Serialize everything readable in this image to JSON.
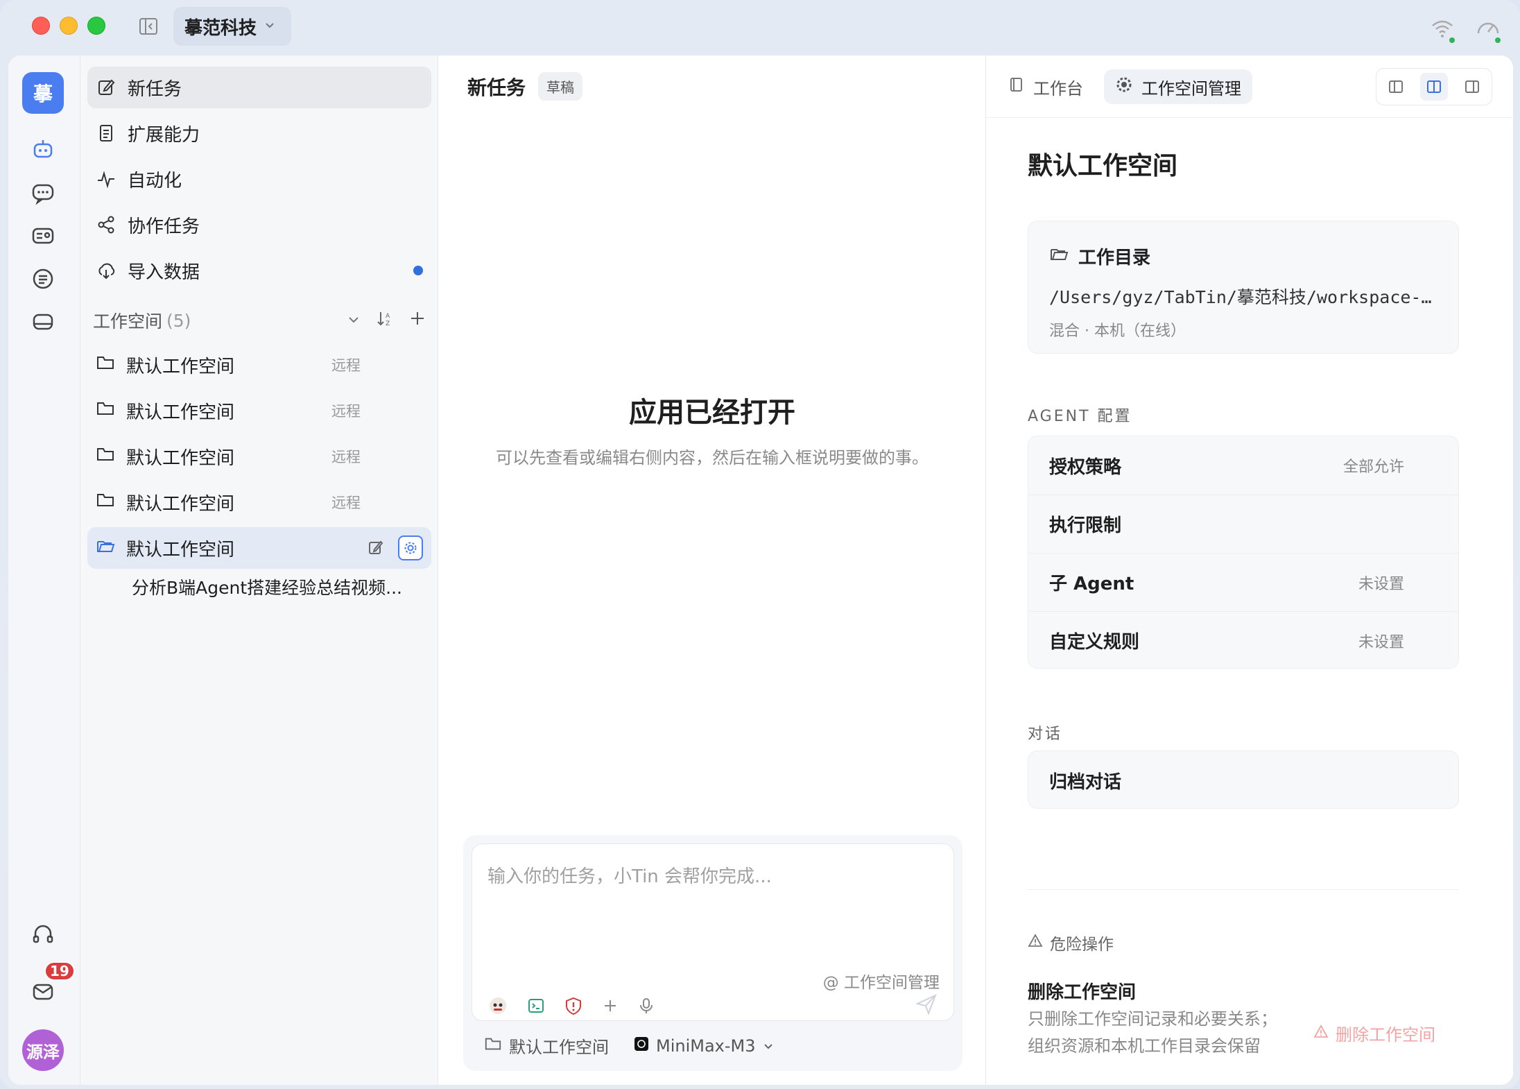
{
  "titlebar": {
    "org_name": "摹范科技"
  },
  "rail": {
    "logo_text": "摹",
    "mail_badge": "19",
    "avatar_text": "源泽"
  },
  "nav": {
    "items": [
      {
        "label": "新任务",
        "icon": "edit-icon"
      },
      {
        "label": "扩展能力",
        "icon": "document-icon"
      },
      {
        "label": "自动化",
        "icon": "pulse-icon"
      },
      {
        "label": "协作任务",
        "icon": "share-icon"
      },
      {
        "label": "导入数据",
        "icon": "cloud-download-icon"
      }
    ]
  },
  "workspaces": {
    "title": "工作空间",
    "count": "(5)",
    "items": [
      {
        "label": "默认工作空间",
        "tag": "远程"
      },
      {
        "label": "默认工作空间",
        "tag": "远程"
      },
      {
        "label": "默认工作空间",
        "tag": "远程"
      },
      {
        "label": "默认工作空间",
        "tag": "远程"
      },
      {
        "label": "默认工作空间",
        "tag": ""
      }
    ],
    "sub_task": "分析B端Agent搭建经验总结视频..."
  },
  "center": {
    "title": "新任务",
    "draft_badge": "草稿",
    "empty_title": "应用已经打开",
    "empty_subtitle": "可以先查看或编辑右侧内容，然后在输入框说明要做的事。",
    "composer_placeholder": "输入你的任务，小Tin 会帮你完成...",
    "mention": "@ 工作空间管理",
    "footer_workspace": "默认工作空间",
    "footer_model": "MiniMax-M3"
  },
  "right": {
    "tabs": [
      "工作台",
      "工作空间管理"
    ],
    "title": "默认工作空间",
    "dir_heading": "工作目录",
    "dir_path": "/Users/gyz/TabTin/摹范科技/workspace-…",
    "dir_sub": "混合 · 本机（在线）",
    "agent_label": "AGENT 配置",
    "config_rows": [
      {
        "label": "授权策略",
        "value": "全部允许"
      },
      {
        "label": "执行限制",
        "value": ""
      },
      {
        "label": "子 Agent",
        "value": "未设置"
      },
      {
        "label": "自定义规则",
        "value": "未设置"
      }
    ],
    "chat_label": "对话",
    "chat_row": "归档对话",
    "danger_label": "危险操作",
    "danger_title": "删除工作空间",
    "danger_desc": "只删除工作空间记录和必要关系；组织资源和本机工作目录会保留",
    "danger_button": "删除工作空间"
  },
  "colors": {
    "accent": "#4a7ef0",
    "badge": "#d93d3d",
    "avatar": "#b061d6",
    "danger": "#f3a3a3",
    "dot": "#2f6fdf"
  }
}
